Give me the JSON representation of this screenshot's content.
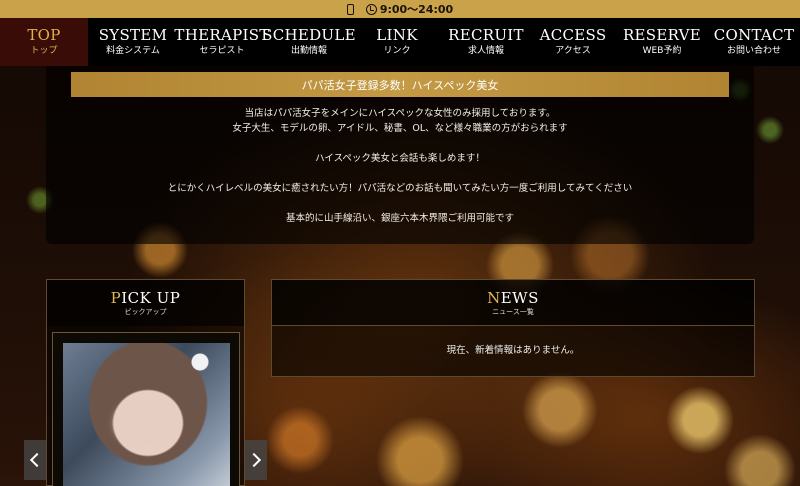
{
  "topbar": {
    "hours": "9:00〜24:00"
  },
  "nav": [
    {
      "en": "TOP",
      "ja": "トップ"
    },
    {
      "en": "SYSTEM",
      "ja": "料金システム"
    },
    {
      "en": "THERAPIST",
      "ja": "セラピスト"
    },
    {
      "en": "SCHEDULE",
      "ja": "出勤情報"
    },
    {
      "en": "LINK",
      "ja": "リンク"
    },
    {
      "en": "RECRUIT",
      "ja": "求人情報"
    },
    {
      "en": "ACCESS",
      "ja": "アクセス"
    },
    {
      "en": "RESERVE",
      "ja": "WEB予約"
    },
    {
      "en": "CONTACT",
      "ja": "お問い合わせ"
    }
  ],
  "intro": {
    "banner": "パパ活女子登録多数！ハイスペック美女",
    "lines": [
      "当店はパパ活女子をメインにハイスペックな女性のみ採用しております。",
      "女子大生、モデルの卵、アイドル、秘書、OL、など様々職業の方がおられます",
      "ハイスペック美女と会話も楽しめます！",
      "とにかくハイレベルの美女に癒されたい方！パパ活などのお話も聞いてみたい方一度ご利用してみてください",
      "基本的に山手線沿い、銀座六本木界隈ご利用可能です"
    ]
  },
  "pickup": {
    "title_first": "P",
    "title_rest": "ICK UP",
    "subtitle": "ピックアップ"
  },
  "news": {
    "title_first": "N",
    "title_rest": "EWS",
    "subtitle": "ニュース一覧",
    "empty_message": "現在、新着情報はありません。"
  },
  "colors": {
    "gold": "#c9a24a",
    "nav_active_bg": "#3a0c07",
    "accent_text": "#e2b85a"
  }
}
